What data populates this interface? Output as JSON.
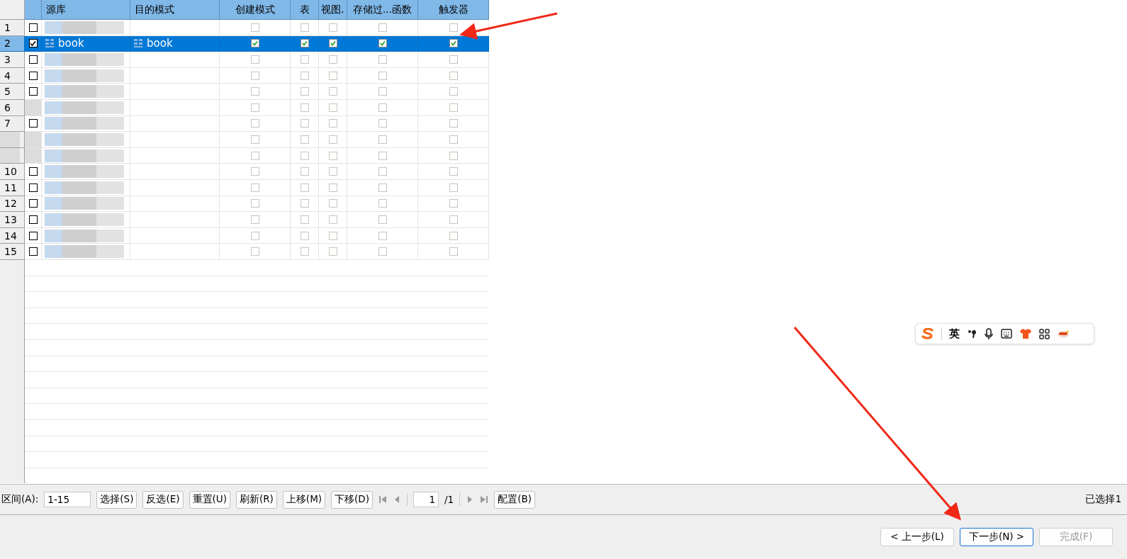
{
  "table": {
    "columns": [
      "源库",
      "目的模式",
      "创建模式",
      "表",
      "视图.",
      "存储过...函数",
      "触发器"
    ],
    "rows": [
      {
        "number": "1",
        "selected": false,
        "checked": false,
        "flags": [
          false,
          false,
          false,
          false,
          false
        ]
      },
      {
        "number": "2",
        "selected": true,
        "checked": true,
        "source": "book",
        "target": "book",
        "flags": [
          true,
          true,
          true,
          true,
          true
        ]
      },
      {
        "number": "3",
        "selected": false,
        "checked": false,
        "flags": [
          false,
          false,
          false,
          false,
          false
        ]
      },
      {
        "number": "4",
        "selected": false,
        "checked": false,
        "flags": [
          false,
          false,
          false,
          false,
          false
        ]
      },
      {
        "number": "5",
        "selected": false,
        "checked": false,
        "flags": [
          false,
          false,
          false,
          false,
          false
        ]
      },
      {
        "number": "6",
        "selected": false,
        "flags": [
          false,
          false,
          false,
          false,
          false
        ]
      },
      {
        "number": "7",
        "selected": false,
        "checked": false,
        "flags": [
          false,
          false,
          false,
          false,
          false
        ]
      },
      {
        "selected": false,
        "flags": [
          false,
          false,
          false,
          false,
          false
        ]
      },
      {
        "selected": false,
        "flags": [
          false,
          false,
          false,
          false,
          false
        ]
      },
      {
        "number": "10",
        "selected": false,
        "checked": false,
        "flags": [
          false,
          false,
          false,
          false,
          false
        ]
      },
      {
        "number": "11",
        "selected": false,
        "checked": false,
        "flags": [
          false,
          false,
          false,
          false,
          false
        ]
      },
      {
        "number": "12",
        "selected": false,
        "checked": false,
        "flags": [
          false,
          false,
          false,
          false,
          false
        ]
      },
      {
        "number": "13",
        "selected": false,
        "checked": false,
        "flags": [
          false,
          false,
          false,
          false,
          false
        ]
      },
      {
        "number": "14",
        "selected": false,
        "checked": false,
        "flags": [
          false,
          false,
          false,
          false,
          false
        ]
      },
      {
        "number": "15",
        "selected": false,
        "checked": false,
        "flags": [
          false,
          false,
          false,
          false,
          false
        ]
      }
    ]
  },
  "toolbar": {
    "range_label": "区间(A):",
    "range_value": "1-15",
    "buttons": [
      "选择(S)",
      "反选(E)",
      "重置(U)",
      "刷新(R)",
      "上移(M)",
      "下移(D)"
    ],
    "page": "1",
    "page_total": "/1",
    "config_button": "配置(B)",
    "selection_status": "已选择1"
  },
  "ime": {
    "mode": "英"
  },
  "footer": {
    "buttons": [
      {
        "label": "< 上一步(L)",
        "focused": false,
        "disabled": false
      },
      {
        "label": "下一步(N) >",
        "focused": true,
        "disabled": false
      },
      {
        "label": "完成(F)",
        "focused": false,
        "disabled": true
      }
    ]
  }
}
